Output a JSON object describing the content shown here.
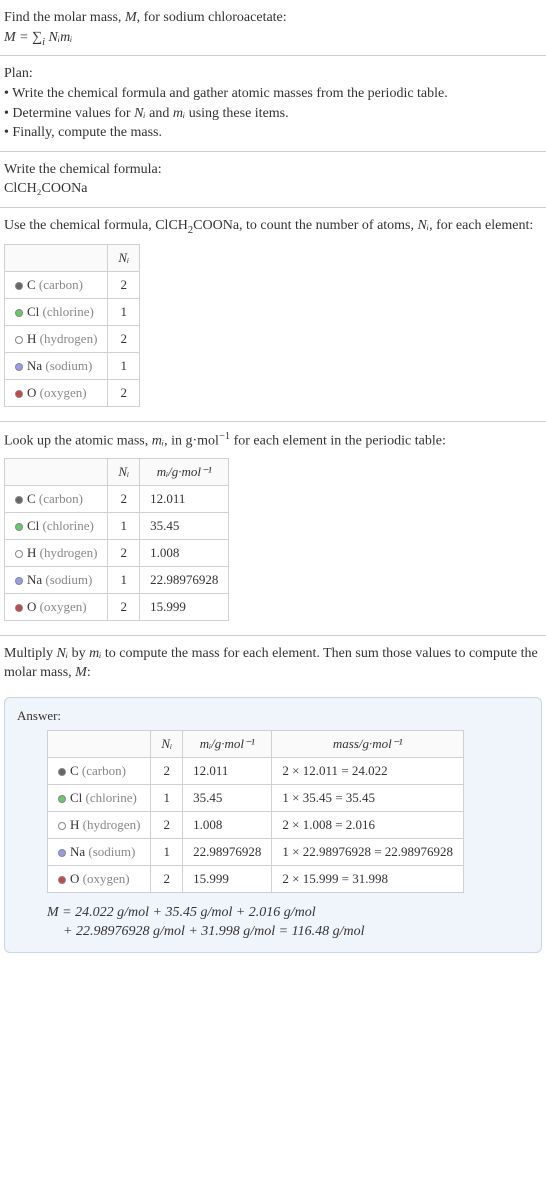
{
  "intro": {
    "line1": "Find the molar mass, ",
    "var1": "M",
    "line1b": ", for sodium chloroacetate:",
    "formula_lhs": "M = ",
    "formula_rhs": "∑",
    "formula_sub": "i",
    "formula_tail": " Nᵢmᵢ"
  },
  "plan": {
    "title": "Plan:",
    "b1": "• Write the chemical formula and gather atomic masses from the periodic table.",
    "b2_a": "• Determine values for ",
    "b2_ni": "Nᵢ",
    "b2_b": " and ",
    "b2_mi": "mᵢ",
    "b2_c": " using these items.",
    "b3": "• Finally, compute the mass."
  },
  "formula_section": {
    "title": "Write the chemical formula:",
    "formula": "ClCH₂COONa"
  },
  "count_section": {
    "text_a": "Use the chemical formula, ClCH",
    "text_sub": "2",
    "text_b": "COONa, to count the number of atoms, ",
    "text_ni": "Nᵢ",
    "text_c": ", for each element:",
    "header_ni": "Nᵢ",
    "rows": [
      {
        "color": "#666",
        "sym": "C",
        "name": "(carbon)",
        "n": "2"
      },
      {
        "color": "#6c6",
        "sym": "Cl",
        "name": "(chlorine)",
        "n": "1"
      },
      {
        "color": "#fff",
        "sym": "H",
        "name": "(hydrogen)",
        "n": "2"
      },
      {
        "color": "#99e",
        "sym": "Na",
        "name": "(sodium)",
        "n": "1"
      },
      {
        "color": "#c44",
        "sym": "O",
        "name": "(oxygen)",
        "n": "2"
      }
    ]
  },
  "mass_section": {
    "text_a": "Look up the atomic mass, ",
    "text_mi": "mᵢ",
    "text_b": ", in g·mol",
    "text_sup": "−1",
    "text_c": " for each element in the periodic table:",
    "header_ni": "Nᵢ",
    "header_mi": "mᵢ/g·mol⁻¹",
    "rows": [
      {
        "color": "#666",
        "sym": "C",
        "name": "(carbon)",
        "n": "2",
        "m": "12.011"
      },
      {
        "color": "#6c6",
        "sym": "Cl",
        "name": "(chlorine)",
        "n": "1",
        "m": "35.45"
      },
      {
        "color": "#fff",
        "sym": "H",
        "name": "(hydrogen)",
        "n": "2",
        "m": "1.008"
      },
      {
        "color": "#99e",
        "sym": "Na",
        "name": "(sodium)",
        "n": "1",
        "m": "22.98976928"
      },
      {
        "color": "#c44",
        "sym": "O",
        "name": "(oxygen)",
        "n": "2",
        "m": "15.999"
      }
    ]
  },
  "compute_section": {
    "text_a": "Multiply ",
    "text_ni": "Nᵢ",
    "text_b": " by ",
    "text_mi": "mᵢ",
    "text_c": " to compute the mass for each element. Then sum those values to compute the molar mass, ",
    "text_m": "M",
    "text_d": ":"
  },
  "answer": {
    "label": "Answer:",
    "header_ni": "Nᵢ",
    "header_mi": "mᵢ/g·mol⁻¹",
    "header_mass": "mass/g·mol⁻¹",
    "rows": [
      {
        "color": "#666",
        "sym": "C",
        "name": "(carbon)",
        "n": "2",
        "m": "12.011",
        "calc": "2 × 12.011 = 24.022"
      },
      {
        "color": "#6c6",
        "sym": "Cl",
        "name": "(chlorine)",
        "n": "1",
        "m": "35.45",
        "calc": "1 × 35.45 = 35.45"
      },
      {
        "color": "#fff",
        "sym": "H",
        "name": "(hydrogen)",
        "n": "2",
        "m": "1.008",
        "calc": "2 × 1.008 = 2.016"
      },
      {
        "color": "#99e",
        "sym": "Na",
        "name": "(sodium)",
        "n": "1",
        "m": "22.98976928",
        "calc": "1 × 22.98976928 = 22.98976928"
      },
      {
        "color": "#c44",
        "sym": "O",
        "name": "(oxygen)",
        "n": "2",
        "m": "15.999",
        "calc": "2 × 15.999 = 31.998"
      }
    ],
    "final_a": "M = 24.022 g/mol + 35.45 g/mol + 2.016 g/mol",
    "final_b": "+ 22.98976928 g/mol + 31.998 g/mol = 116.48 g/mol"
  }
}
